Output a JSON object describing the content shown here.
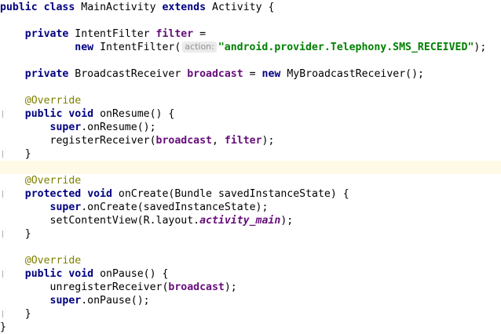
{
  "editor": {
    "language": "java",
    "highlighted_line": 13,
    "colors": {
      "keyword": "#000080",
      "string": "#008000",
      "annotation": "#808000",
      "field": "#660e7a",
      "current_line_bg": "#fefae5",
      "hint_bg": "#ebebeb"
    },
    "lines": [
      [
        "kw",
        "public class "
      ],
      [
        "",
        "MainActivity "
      ],
      [
        "kw",
        "extends "
      ],
      [
        "",
        "Activity {"
      ],
      "__1",
      "__2",
      "__3",
      "__4",
      "__5",
      "__6",
      "__7",
      "__8",
      "__9",
      "__10",
      "__11",
      "__12"
    ]
  },
  "code": {
    "l1": {
      "kw_public": "public",
      "kw_class": "class",
      "name": "MainActivity",
      "kw_extends": "extends",
      "parent": "Activity {"
    },
    "l3": {
      "kw_private": "private",
      "type": "IntentFilter",
      "field": "filter",
      "eq": " ="
    },
    "l4": {
      "kw_new": "new",
      "ctor": "IntentFilter(",
      "hint": "action:",
      "str": "\"android.provider.Telephony.SMS_RECEIVED\"",
      "end": ");"
    },
    "l6": {
      "kw_private": "private",
      "type": "BroadcastReceiver",
      "field": "broadcast",
      "eq": " = ",
      "kw_new": "new",
      "rest": "MyBroadcastReceiver();"
    },
    "l8": {
      "ann": "@Override"
    },
    "l9": {
      "kw_public": "public",
      "kw_void": "void",
      "rest": "onResume() {"
    },
    "l10": {
      "kw_super": "super",
      "rest": ".onResume();"
    },
    "l11": {
      "call": "registerReceiver(",
      "arg1": "broadcast",
      "sep": ", ",
      "arg2": "filter",
      "end": ");"
    },
    "l12": {
      "brace": "}"
    },
    "l14": {
      "ann": "@Override"
    },
    "l15": {
      "kw_protected": "protected",
      "kw_void": "void",
      "rest": "onCreate(Bundle savedInstanceState) {"
    },
    "l16": {
      "kw_super": "super",
      "rest": ".onCreate(savedInstanceState);"
    },
    "l17": {
      "call": "setContentView(R.layout.",
      "field": "activity_main",
      "end": ");"
    },
    "l18": {
      "brace": "}"
    },
    "l20": {
      "ann": "@Override"
    },
    "l21": {
      "kw_public": "public",
      "kw_void": "void",
      "rest": "onPause() {"
    },
    "l22": {
      "call": "unregisterReceiver(",
      "arg": "broadcast",
      "end": ");"
    },
    "l23": {
      "kw_super": "super",
      "rest": ".onPause();"
    },
    "l24": {
      "brace": "}"
    },
    "l25": {
      "brace": "}"
    }
  }
}
